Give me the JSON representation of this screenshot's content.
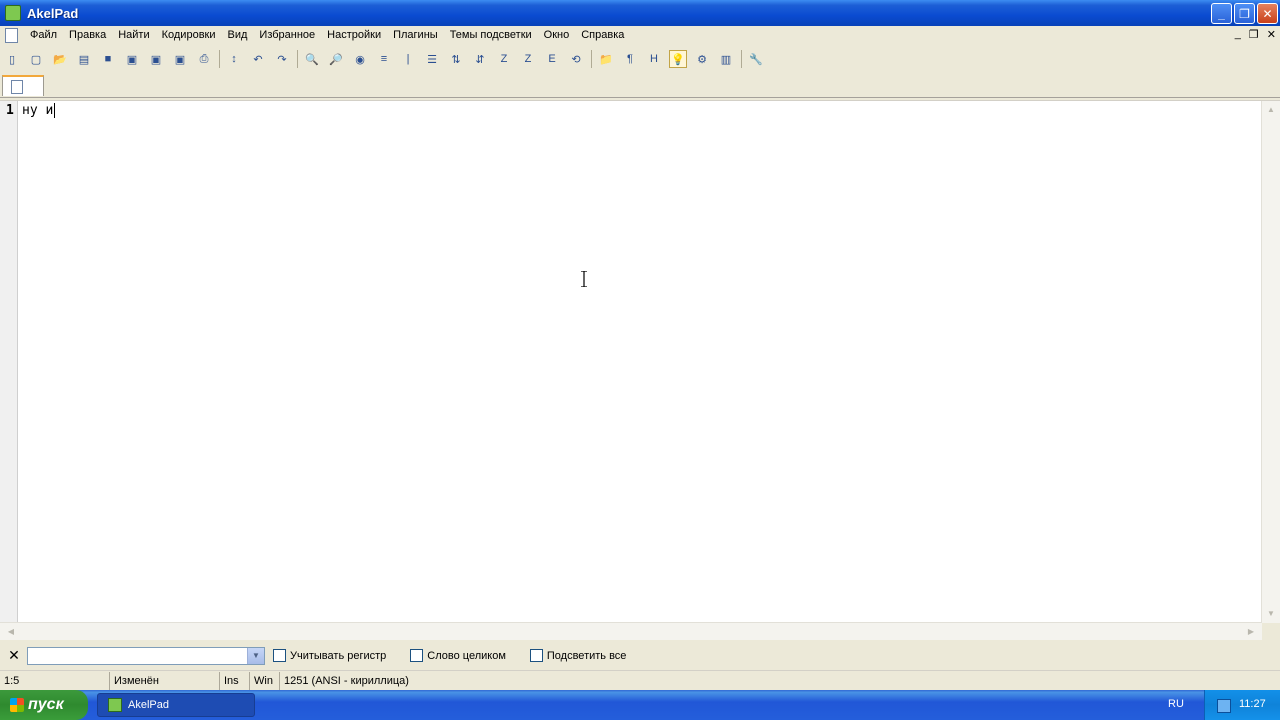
{
  "window": {
    "title": "AkelPad"
  },
  "menu": [
    "Файл",
    "Правка",
    "Найти",
    "Кодировки",
    "Вид",
    "Избранное",
    "Настройки",
    "Плагины",
    "Темы подсветки",
    "Окно",
    "Справка"
  ],
  "toolbar_icons": [
    "new-icon",
    "open-icon",
    "open-dropdown-icon",
    "copy-icon",
    "save-icon",
    "save-all-icon",
    "save-as-icon",
    "print-icon",
    "undo-icon",
    "redo-icon",
    "find-icon",
    "replace-icon",
    "go-icon",
    "insert-icon",
    "wrap-icon",
    "sort-icon",
    "sort-desc-icon",
    "case-icon",
    "case2-icon",
    "convert-icon",
    "refresh-icon",
    "folder-icon",
    "paragraph-icon",
    "hex-icon",
    "lightbulb-icon",
    "settings-icon",
    "tools-icon",
    "search-icon"
  ],
  "editor": {
    "line_number": "1",
    "text": "ну и"
  },
  "findbar": {
    "close": "✕",
    "input_value": "",
    "options": [
      "Учитывать регистр",
      "Слово целиком",
      "Подсветить все"
    ]
  },
  "status": {
    "position": "1:5",
    "modified": "Изменён",
    "insert_mode": "Ins",
    "newline": "Win",
    "encoding": "1251  (ANSI - кириллица)"
  },
  "taskbar": {
    "start_label": "пуск",
    "task_label": "AkelPad",
    "lang": "RU",
    "clock": "11:27"
  }
}
